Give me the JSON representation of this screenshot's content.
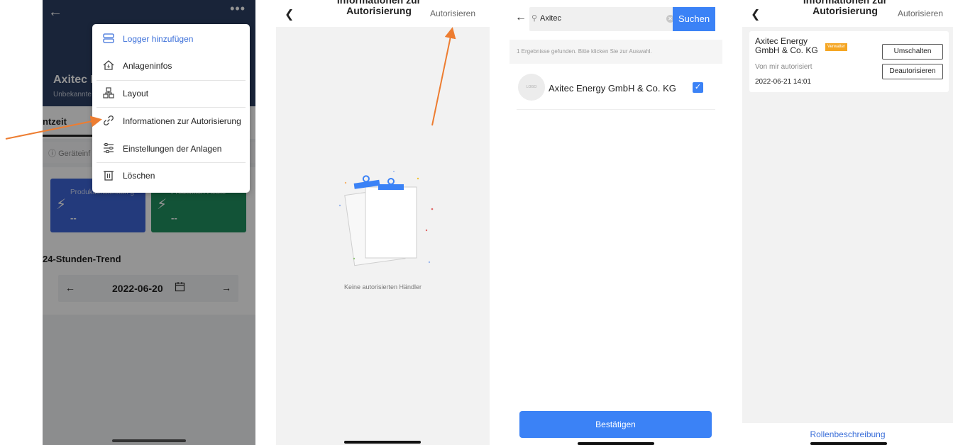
{
  "screen1": {
    "station_title": "Axitec E",
    "station_subtitle": "Unbekannte",
    "active_tab": "ntzeit",
    "device_info": "Geräteinf",
    "card_blue_label": "Produktionsleistun g",
    "card_blue_value": "--",
    "card_green_label": "Produktion Heute",
    "card_green_value": "--",
    "trend_title": "24-Stunden-Trend",
    "trend_date": "2022-06-20",
    "menu": [
      {
        "label": "Logger hinzufügen",
        "icon": "logger-icon"
      },
      {
        "label": "Anlageninfos",
        "icon": "home-icon"
      },
      {
        "label": "Layout",
        "icon": "layout-icon"
      },
      {
        "label": "Informationen zur Autorisierung",
        "icon": "link-icon"
      },
      {
        "label": "Einstellungen der Anlagen",
        "icon": "settings-sliders-icon"
      },
      {
        "label": "Löschen",
        "icon": "trash-icon"
      }
    ]
  },
  "screen2": {
    "title_line1": "Informationen zur",
    "title_line2": "Autorisierung",
    "action": "Autorisieren",
    "empty_text": "Keine autorisierten Händler"
  },
  "screen3": {
    "search_value": "Axitec",
    "search_button": "Suchen",
    "result_info": "1 Ergebnisse gefunden. Bitte klicken Sie zur Auswahl.",
    "logo_text": "LOGO",
    "result_name": "Axitec Energy GmbH & Co. KG",
    "confirm_button": "Bestätigen"
  },
  "screen4": {
    "title_line1": "Informationen zur",
    "title_line2": "Autorisierung",
    "action": "Autorisieren",
    "company": "Axitec Energy GmbH & Co. KG",
    "badge": "Verwalter",
    "authorized_by": "Von mir autorisiert",
    "date": "2022-06-21 14:01",
    "switch_button": "Umschalten",
    "deauth_button": "Deautorisieren",
    "role_link": "Rollenbeschreibung"
  },
  "colors": {
    "accent_blue": "#3b82f6",
    "arrow_orange": "#ed7d31",
    "card_blue": "#3d64d6",
    "card_green": "#1f8f5f",
    "badge_orange": "#f5a623"
  }
}
